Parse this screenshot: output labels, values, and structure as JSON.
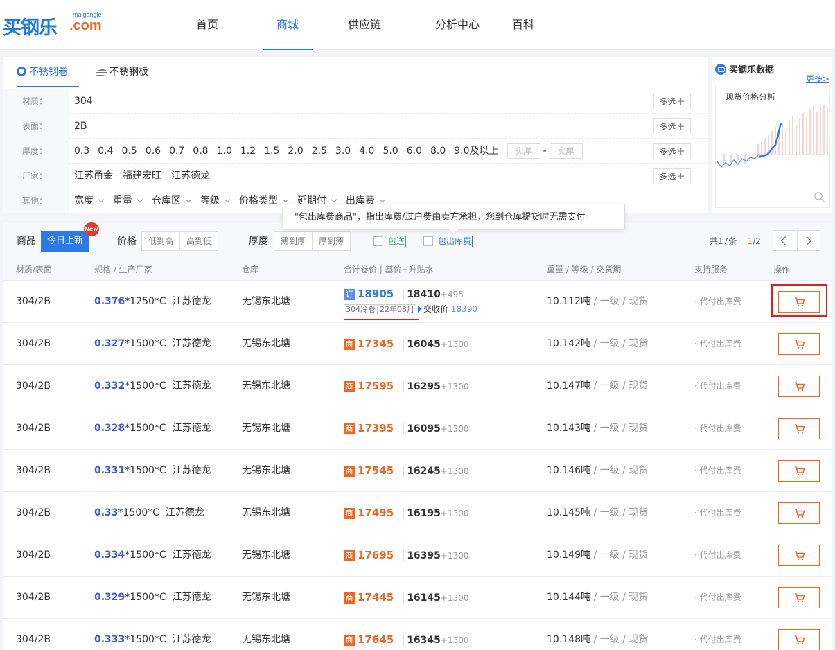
{
  "header": {
    "logo_cn": "买钢乐",
    "logo_en": "maigangle",
    "logo_com": ".com",
    "nav": [
      "首页",
      "商城",
      "供应链",
      "分析中心",
      "百科"
    ],
    "active_nav": "商城"
  },
  "filter": {
    "tabs": [
      "不锈钢卷",
      "不锈钢板"
    ],
    "material_label": "材质：",
    "material_values": [
      "304"
    ],
    "surface_label": "表面：",
    "surface_values": [
      "2B"
    ],
    "thickness_label": "厚度：",
    "thickness_values": [
      "0.3",
      "0.4",
      "0.5",
      "0.6",
      "0.7",
      "0.8",
      "1.0",
      "1.2",
      "1.5",
      "2.0",
      "2.5",
      "3.0",
      "4.0",
      "5.0",
      "6.0",
      "8.0",
      "9.0及以上"
    ],
    "range_placeholder_from": "实厚",
    "range_placeholder_to": "实厚",
    "range_dash": "-",
    "maker_label": "厂家：",
    "maker_values": [
      "江苏甬金",
      "福建宏旺",
      "江苏德龙"
    ],
    "other_label": "其他：",
    "other_values": [
      "宽度",
      "重量",
      "仓库区",
      "等级",
      "价格类型",
      "延期付",
      "出库费"
    ],
    "multi_label": "多选",
    "multi_plus": "+"
  },
  "tooltip": "\"包出库费商品\"，指出库费/过户费由卖方承担，您到仓库提货时无需支付。",
  "side": {
    "title": "买钢乐数据",
    "more": "更多>",
    "chart_title": "现货价格分析",
    "zoom_icon": "magnifier-icon"
  },
  "listbar": {
    "goods_label": "商品",
    "today_new": "今日上新",
    "new_badge": "New",
    "price_label": "价格",
    "price_sort": [
      "低到高",
      "高到低"
    ],
    "thick_label": "厚度",
    "thick_sort": [
      "薄到厚",
      "厚到薄"
    ],
    "tag_free_ship": "包送",
    "tag_free_out": "包出库费",
    "total": "共17条",
    "page_cur": "1",
    "page_sep": "/",
    "page_total": "2"
  },
  "table": {
    "headers": [
      "材质/表面",
      "规格 / 生产厂家",
      "仓库",
      "合计卷价 | 基价+升贴水",
      "重量 / 等级 / 交货期",
      "支持服务",
      "操作"
    ],
    "first_row": {
      "material": "304/2B",
      "spec_thk": "0.376",
      "spec_rest": "*1250*C",
      "maker": "江苏德龙",
      "warehouse": "无锡东北塘",
      "tag": "订",
      "total": "18905",
      "base": "18410",
      "premium": "+495",
      "mini1": "304冷卷",
      "mini2": "22年08月",
      "deal_label": "交收价",
      "deal_value": "18390",
      "weight": "10.112吨",
      "grade": "一级",
      "delivery": "现货",
      "service": "· 代付出库费"
    },
    "rows": [
      {
        "material": "304/2B",
        "thk": "0.327",
        "rest": "*1500*C",
        "maker": "江苏德龙",
        "warehouse": "无锡东北塘",
        "tag": "商",
        "total": "17345",
        "base": "16045",
        "premium": "+1300",
        "weight": "10.142吨",
        "grade": "一级",
        "delivery": "现货",
        "service": "· 代付出库费"
      },
      {
        "material": "304/2B",
        "thk": "0.332",
        "rest": "*1500*C",
        "maker": "江苏德龙",
        "warehouse": "无锡东北塘",
        "tag": "商",
        "total": "17595",
        "base": "16295",
        "premium": "+1300",
        "weight": "10.147吨",
        "grade": "一级",
        "delivery": "现货",
        "service": "· 代付出库费"
      },
      {
        "material": "304/2B",
        "thk": "0.328",
        "rest": "*1500*C",
        "maker": "江苏德龙",
        "warehouse": "无锡东北塘",
        "tag": "商",
        "total": "17395",
        "base": "16095",
        "premium": "+1300",
        "weight": "10.143吨",
        "grade": "一级",
        "delivery": "现货",
        "service": "· 代付出库费"
      },
      {
        "material": "304/2B",
        "thk": "0.331",
        "rest": "*1500*C",
        "maker": "江苏德龙",
        "warehouse": "无锡东北塘",
        "tag": "商",
        "total": "17545",
        "base": "16245",
        "premium": "+1300",
        "weight": "10.146吨",
        "grade": "一级",
        "delivery": "现货",
        "service": "· 代付出库费"
      },
      {
        "material": "304/2B",
        "thk": "0.33",
        "rest": "*1500*C",
        "maker": "江苏德龙",
        "warehouse": "无锡东北塘",
        "tag": "商",
        "total": "17495",
        "base": "16195",
        "premium": "+1300",
        "weight": "10.145吨",
        "grade": "一级",
        "delivery": "现货",
        "service": "· 代付出库费"
      },
      {
        "material": "304/2B",
        "thk": "0.334",
        "rest": "*1500*C",
        "maker": "江苏德龙",
        "warehouse": "无锡东北塘",
        "tag": "商",
        "total": "17695",
        "base": "16395",
        "premium": "+1300",
        "weight": "10.149吨",
        "grade": "一级",
        "delivery": "现货",
        "service": "· 代付出库费"
      },
      {
        "material": "304/2B",
        "thk": "0.329",
        "rest": "*1500*C",
        "maker": "江苏德龙",
        "warehouse": "无锡东北塘",
        "tag": "商",
        "total": "17445",
        "base": "16145",
        "premium": "+1300",
        "weight": "10.144吨",
        "grade": "一级",
        "delivery": "现货",
        "service": "· 代付出库费"
      },
      {
        "material": "304/2B",
        "thk": "0.333",
        "rest": "*1500*C",
        "maker": "江苏德龙",
        "warehouse": "无锡东北塘",
        "tag": "商",
        "total": "17645",
        "base": "16345",
        "premium": "+1300",
        "weight": "10.148吨",
        "grade": "一级",
        "delivery": "现货",
        "service": "· 代付出库费"
      }
    ],
    "sep": " / "
  },
  "colors": {
    "brand_blue": "#2c7be5",
    "accent_orange": "#f26622",
    "highlight_red": "#e02020"
  },
  "icons": {
    "cart": "cart-icon",
    "coil": "coil-icon",
    "plate": "plate-icon",
    "prev": "chevron-left-icon",
    "next": "chevron-right-icon"
  }
}
